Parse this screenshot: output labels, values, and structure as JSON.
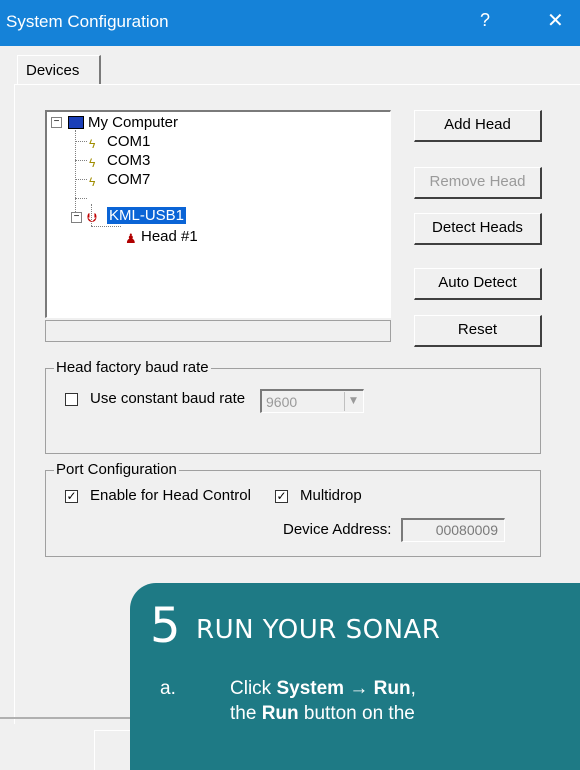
{
  "window": {
    "title": "System Configuration",
    "help_glyph": "?",
    "close_glyph": "✕"
  },
  "tabs": [
    {
      "label": "Devices"
    }
  ],
  "tree": {
    "root": {
      "label": "My Computer",
      "icon": "computer-icon",
      "expanded": true
    },
    "ports": [
      {
        "label": "COM1",
        "icon": "serial-port-icon"
      },
      {
        "label": "COM3",
        "icon": "serial-port-icon"
      },
      {
        "label": "COM7",
        "icon": "serial-port-icon"
      }
    ],
    "usb": {
      "label": "KML-USB1",
      "icon": "usb-device-icon",
      "expanded": true,
      "selected": true
    },
    "head": {
      "label": "Head #1",
      "icon": "sonar-head-icon"
    },
    "expander_minus": "−"
  },
  "buttons": {
    "add_head": "Add Head",
    "remove_head": "Remove Head",
    "detect_heads": "Detect Heads",
    "auto_detect": "Auto Detect",
    "reset": "Reset"
  },
  "baud": {
    "legend": "Head factory baud rate",
    "use_constant_label": "Use constant baud rate",
    "use_constant_checked": false,
    "rate_value": "9600",
    "dropdown_glyph": "▼"
  },
  "port_config": {
    "legend": "Port Configuration",
    "enable_head_control_label": "Enable for Head Control",
    "enable_head_control_checked": true,
    "multidrop_label": "Multidrop",
    "multidrop_checked": true,
    "device_address_label": "Device Address:",
    "device_address_value": "00080009",
    "check_glyph": "✓"
  },
  "overlay": {
    "number": "5",
    "heading": "RUN YOUR SONAR",
    "step_letter": "a.",
    "line1_pre": "Click ",
    "line1_bold1": "System",
    "line1_mid": " → ",
    "line1_bold2": "Run",
    "line1_post": ",",
    "line2_pre": "the ",
    "line2_bold": "Run",
    "line2_post": " button on the",
    "colors": {
      "card": "#1e7a85",
      "titlebar": "#1582d8"
    }
  }
}
